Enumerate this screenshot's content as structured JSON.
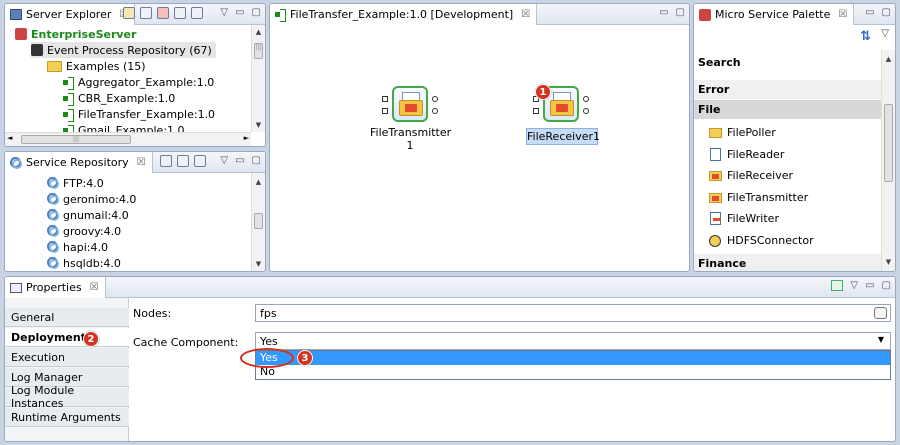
{
  "server_explorer": {
    "tab_title": "Server Explorer",
    "server": "EnterpriseServer",
    "repository": "Event Process Repository (67)",
    "folder": "Examples (15)",
    "items": [
      "Aggregator_Example:1.0",
      "CBR_Example:1.0",
      "FileTransfer_Example:1.0",
      "Gmail_Example:1.0"
    ],
    "scroll_up": "▲",
    "scroll_down": "▼",
    "scroll_left": "◄",
    "scroll_right": "►",
    "grip": "|||"
  },
  "service_repository": {
    "tab_title": "Service Repository",
    "items": [
      "FTP:4.0",
      "geronimo:4.0",
      "gnumail:4.0",
      "groovy:4.0",
      "hapi:4.0",
      "hsqldb:4.0"
    ]
  },
  "editor": {
    "tab_title": "FileTransfer_Example:1.0 [Development]",
    "nodes": [
      {
        "label": "FileTransmitter",
        "sublabel": "1"
      },
      {
        "label": "FileReceiver1",
        "sublabel": ""
      }
    ]
  },
  "palette": {
    "tab_title": "Micro Service Palette",
    "search_label": "Search",
    "sections": [
      "Error",
      "File",
      "Finance"
    ],
    "file_items": [
      "FilePoller",
      "FileReader",
      "FileReceiver",
      "FileTransmitter",
      "FileWriter",
      "HDFSConnector"
    ]
  },
  "properties": {
    "tab_title": "Properties",
    "side_tabs": [
      "General",
      "Deployment",
      "Execution",
      "Log Manager",
      "Log Module Instances",
      "Runtime Arguments"
    ],
    "selected_tab": "Deployment",
    "nodes_label": "Nodes:",
    "nodes_value": "fps",
    "cache_label": "Cache Component:",
    "cache_value": "Yes",
    "cache_options": [
      "Yes",
      "No"
    ]
  },
  "annotations": [
    "1",
    "2",
    "3"
  ],
  "colors": {
    "accent": "#3399ff",
    "badge": "#d3331f",
    "selection": "#3399ff"
  },
  "glyphs": {
    "close": "☒",
    "minimize": "▭",
    "maximize": "▢",
    "dropdown": "▾",
    "chevron": "▼",
    "sync": "⇅",
    "expand": "▽",
    "sort": "⇵"
  }
}
